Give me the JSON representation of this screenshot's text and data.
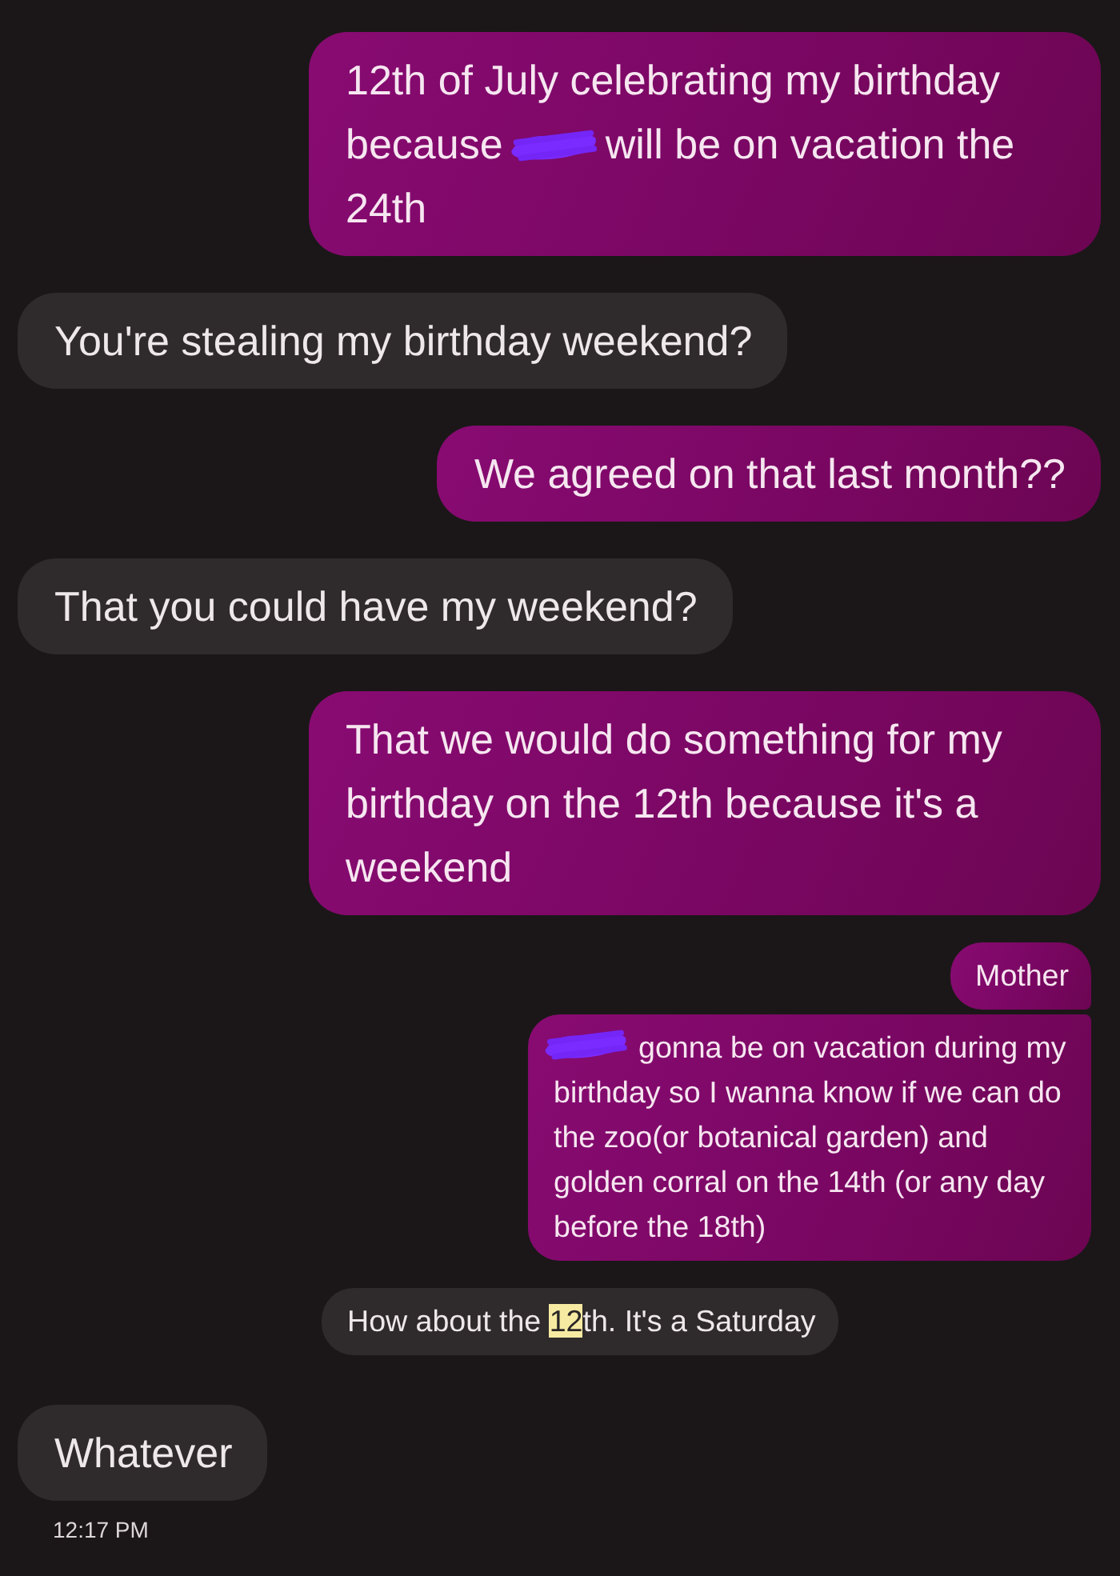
{
  "messages": [
    {
      "kind": "sent",
      "parts": [
        {
          "kind": "line",
          "text": "12th of July celebrating my birthday"
        },
        {
          "kind": "line",
          "text": "because"
        },
        {
          "kind": "redaction"
        },
        {
          "kind": "line",
          "text": "will be on vacation the"
        },
        {
          "kind": "line",
          "text": "24th"
        }
      ]
    },
    {
      "kind": "received",
      "parts": [
        {
          "kind": "text",
          "text": "You're stealing my birthday weekend?"
        }
      ]
    },
    {
      "kind": "sent",
      "parts": [
        {
          "kind": "text",
          "text": "We agreed on that last month??"
        }
      ]
    },
    {
      "kind": "received",
      "parts": [
        {
          "kind": "text",
          "text": "That you could have my weekend?"
        }
      ]
    },
    {
      "kind": "sent",
      "parts": [
        {
          "kind": "text",
          "text": "That we would do something for my birthday on the 12th because it's a weekend"
        }
      ]
    },
    {
      "kind": "quoted-sent",
      "parts": [
        {
          "kind": "text",
          "text": "Mother"
        }
      ]
    },
    {
      "kind": "quoted-sent",
      "parts": [
        {
          "kind": "redaction"
        },
        {
          "kind": "line",
          "text": "gonna be on vacation during my"
        },
        {
          "kind": "text",
          "text": "birthday so I wanna know if we can do the zoo(or botanical garden) and golden corral on the 14th (or any day before the 18th)"
        }
      ]
    },
    {
      "kind": "quoted-received",
      "parts": [
        {
          "kind": "text",
          "text": "How about the "
        },
        {
          "kind": "highlight",
          "text": "12"
        },
        {
          "kind": "text",
          "text": "th. It's a Saturday"
        }
      ]
    },
    {
      "kind": "received",
      "parts": [
        {
          "kind": "text",
          "text": "Whatever"
        }
      ]
    }
  ],
  "timestamp": "12:17 PM"
}
